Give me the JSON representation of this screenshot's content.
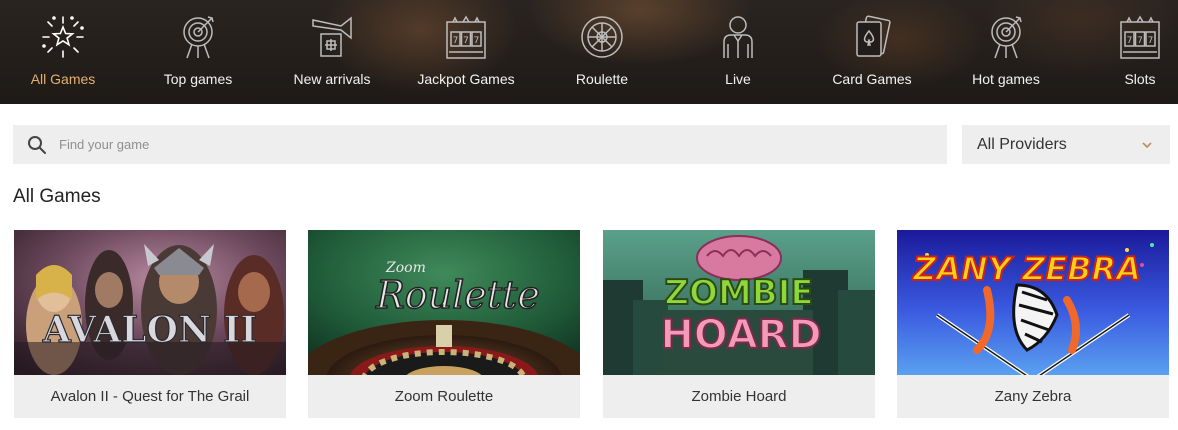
{
  "categories": [
    {
      "label": "All Games",
      "icon": "fireworks-icon",
      "active": true
    },
    {
      "label": "Top games",
      "icon": "target-icon"
    },
    {
      "label": "New arrivals",
      "icon": "trumpet-icon"
    },
    {
      "label": "Jackpot Games",
      "icon": "slot-machine-icon"
    },
    {
      "label": "Roulette",
      "icon": "roulette-wheel-icon"
    },
    {
      "label": "Live",
      "icon": "dealer-icon"
    },
    {
      "label": "Card Games",
      "icon": "playing-cards-icon"
    },
    {
      "label": "Hot games",
      "icon": "target-icon"
    },
    {
      "label": "Slots",
      "icon": "slot-machine-icon"
    }
  ],
  "search": {
    "placeholder": "Find your game",
    "value": "",
    "icon": "search-icon"
  },
  "providers": {
    "selected": "All Providers",
    "icon": "chevron-down-icon"
  },
  "section_title": "All Games",
  "games": [
    {
      "name": "Avalon II - Quest for The Grail",
      "logo": "AVALON II"
    },
    {
      "name": "Zoom Roulette",
      "logo_small": "Zoom",
      "logo": "Roulette"
    },
    {
      "name": "Zombie Hoard",
      "logo_top": "ZOMBIE",
      "logo_bottom": "HOARD"
    },
    {
      "name": "Zany Zebra",
      "logo": "ZANY ZEBRA"
    }
  ],
  "colors": {
    "active_category": "#e6b06c",
    "nav_background": "#221d1a",
    "field_background": "#eeeeee"
  }
}
